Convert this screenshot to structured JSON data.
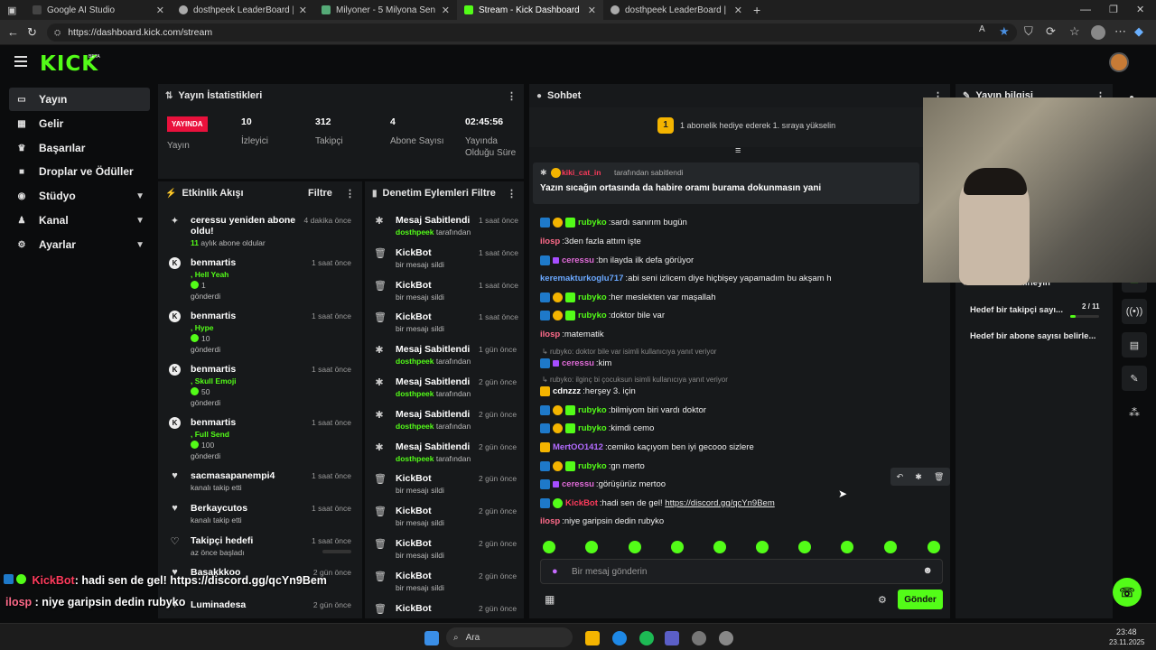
{
  "browser": {
    "tabs": [
      {
        "title": "Google AI Studio",
        "active": false
      },
      {
        "title": "dosthpeek LeaderBoard | The bes",
        "active": false
      },
      {
        "title": "Milyoner - 5 Milyona Sen de Ulaş",
        "active": false
      },
      {
        "title": "Stream - Kick Dashboard",
        "active": true
      },
      {
        "title": "dosthpeek LeaderBoard | The bes",
        "active": false
      }
    ],
    "url": "https://dashboard.kick.com/stream"
  },
  "brand": {
    "logo": "KICK",
    "beta": "BETA",
    "accent": "#53fc18"
  },
  "sidebar": [
    {
      "label": "Yayın",
      "icon": "screen-icon",
      "active": true
    },
    {
      "label": "Gelir",
      "icon": "dollar-icon"
    },
    {
      "label": "Başarılar",
      "icon": "trophy-icon"
    },
    {
      "label": "Droplar ve Ödüller",
      "icon": "gift-icon"
    },
    {
      "label": "Stüdyo",
      "icon": "studio-icon",
      "expandable": true
    },
    {
      "label": "Kanal",
      "icon": "person-icon",
      "expandable": true
    },
    {
      "label": "Ayarlar",
      "icon": "gear-icon",
      "expandable": true
    }
  ],
  "stats": {
    "title": "Yayın İstatistikleri",
    "live_badge": "YAYINDA",
    "live_label": "Yayın",
    "viewers": "10",
    "viewers_label": "İzleyici",
    "followers": "312",
    "followers_label": "Takipçi",
    "subs": "4",
    "subs_label": "Abone Sayısı",
    "duration": "02:45:56",
    "duration_label_1": "Yayında",
    "duration_label_2": "Olduğu Süre"
  },
  "activity": {
    "title": "Etkinlik Akışı",
    "filter": "Filtre",
    "items": [
      {
        "name": "ceressu yeniden abone oldu!",
        "time": "4 dakika önce",
        "sub": "11 aylık abone oldular"
      },
      {
        "name": "benmartis",
        "time": "1 saat önce",
        "gift": ", Hell Yeah",
        "count": "1",
        "sent": "gönderdi"
      },
      {
        "name": "benmartis",
        "time": "1 saat önce",
        "gift": ", Hype",
        "count": "10",
        "sent": "gönderdi"
      },
      {
        "name": "benmartis",
        "time": "1 saat önce",
        "gift": ", Skull Emoji",
        "count": "50",
        "sent": "gönderdi"
      },
      {
        "name": "benmartis",
        "time": "1 saat önce",
        "gift": ", Full Send",
        "count": "100",
        "sent": "gönderdi"
      },
      {
        "name": "sacmasapanempi4",
        "time": "1 saat önce",
        "sub": "kanalı takip etti"
      },
      {
        "name": "Berkaycutos",
        "time": "1 saat önce",
        "sub": "kanalı takip etti"
      },
      {
        "name": "Takipçi hedefi",
        "time": "1 saat önce",
        "sub": "az önce başladı"
      },
      {
        "name": "Basakkkoo",
        "time": "2 gün önce",
        "sub": ""
      },
      {
        "name": "Luminadesa",
        "time": "2 gün önce",
        "sub": ""
      }
    ]
  },
  "moderation": {
    "title": "Denetim Eylemleri",
    "filter": "Filtre",
    "items": [
      {
        "type": "pin",
        "name": "Mesaj Sabitlendi",
        "by": "dosthpeek",
        "suffix": "tarafından",
        "time": "1 saat önce"
      },
      {
        "type": "trash",
        "name": "KickBot",
        "sub": "bir mesajı sildi",
        "time": "1 saat önce"
      },
      {
        "type": "trash",
        "name": "KickBot",
        "sub": "bir mesajı sildi",
        "time": "1 saat önce"
      },
      {
        "type": "trash",
        "name": "KickBot",
        "sub": "bir mesajı sildi",
        "time": "1 saat önce"
      },
      {
        "type": "pin",
        "name": "Mesaj Sabitlendi",
        "by": "dosthpeek",
        "suffix": "tarafından",
        "time": "1 gün önce"
      },
      {
        "type": "pin",
        "name": "Mesaj Sabitlendi",
        "by": "dosthpeek",
        "suffix": "tarafından",
        "time": "2 gün önce"
      },
      {
        "type": "pin",
        "name": "Mesaj Sabitlendi",
        "by": "dosthpeek",
        "suffix": "tarafından",
        "time": "2 gün önce"
      },
      {
        "type": "pin",
        "name": "Mesaj Sabitlendi",
        "by": "dosthpeek",
        "suffix": "tarafından",
        "time": "2 gün önce"
      },
      {
        "type": "trash",
        "name": "KickBot",
        "sub": "bir mesajı sildi",
        "time": "2 gün önce"
      },
      {
        "type": "trash",
        "name": "KickBot",
        "sub": "bir mesajı sildi",
        "time": "2 gün önce"
      },
      {
        "type": "trash",
        "name": "KickBot",
        "sub": "bir mesajı sildi",
        "time": "2 gün önce"
      },
      {
        "type": "trash",
        "name": "KickBot",
        "sub": "bir mesajı sildi",
        "time": "2 gün önce"
      },
      {
        "type": "trash",
        "name": "KickBot",
        "sub": "",
        "time": "2 gün önce"
      }
    ]
  },
  "chat": {
    "title": "Sohbet",
    "gift_banner": "1 abonelik hediye ederek 1. sıraya yükselin",
    "gift_rank": "1",
    "pinned_by_user": "kiki_cat_in",
    "pinned_by_suffix": "tarafından sabitlendi",
    "pinned_text": "Yazın sıcağın ortasında da habire oramı burama dokunmasın yani",
    "messages": [
      {
        "user": "rubyko",
        "color": "#53fc18",
        "text": "sardı sanırım bugün",
        "badges": [
          "blue",
          "gold",
          "green"
        ]
      },
      {
        "user": "ilosp",
        "color": "#ff6b8a",
        "text": "3den fazla attım işte",
        "badges": []
      },
      {
        "user": "ceressu",
        "color": "#e06bd8",
        "text": "bn ilayda ilk defa görüyor",
        "badges": [
          "blue",
          "purple"
        ]
      },
      {
        "user": "keremakturkoglu717",
        "color": "#6aa8ff",
        "text": "abi seni izlicem diye hiçbişey yapamadım bu akşam h",
        "badges": []
      },
      {
        "user": "rubyko",
        "color": "#53fc18",
        "text": "her meslekten var maşallah",
        "badges": [
          "blue",
          "gold",
          "green"
        ]
      },
      {
        "user": "rubyko",
        "color": "#53fc18",
        "text": "doktor bile var",
        "badges": [
          "blue",
          "gold",
          "green"
        ]
      },
      {
        "user": "ilosp",
        "color": "#ff6b8a",
        "text": "matematik",
        "badges": []
      },
      {
        "reply": "rubyko: doktor bile var isimli kullanıcıya yanıt veriyor"
      },
      {
        "user": "ceressu",
        "color": "#e06bd8",
        "text": "kim",
        "badges": [
          "blue",
          "purple"
        ]
      },
      {
        "reply": "rubyko: ilginç bi çocuksun isimli kullanıcıya yanıt veriyor"
      },
      {
        "user": "cdnzzz",
        "color": "#ffffff",
        "text": "herşey 3. için",
        "badges": [
          "crown"
        ]
      },
      {
        "user": "rubyko",
        "color": "#53fc18",
        "text": "bilmiyom biri vardı doktor",
        "badges": [
          "blue",
          "gold",
          "green"
        ]
      },
      {
        "user": "rubyko",
        "color": "#53fc18",
        "text": "kimdi cemo",
        "badges": [
          "blue",
          "gold",
          "green"
        ]
      },
      {
        "user": "MertOO1412",
        "color": "#b36bff",
        "text": "cemiko kaçıyom ben iyi gecooo sizlere",
        "badges": [
          "crown"
        ]
      },
      {
        "user": "rubyko",
        "color": "#53fc18",
        "text": "gn merto",
        "badges": [
          "blue",
          "gold",
          "green"
        ]
      },
      {
        "user": "ceressu",
        "color": "#e06bd8",
        "text": "görüşürüz mertoo",
        "badges": [
          "blue",
          "purple"
        ]
      },
      {
        "user": "KickBot",
        "color": "#ff3b5c",
        "text": "hadi sen de gel! ",
        "link": "https://discord.gg/qcYn9Bem",
        "badges": [
          "blue",
          "greencheck"
        ]
      },
      {
        "user": "ilosp",
        "color": "#ff6b8a",
        "text": "niye garipsin dedin rubyko",
        "badges": []
      }
    ],
    "input_placeholder": "Bir mesaj gönderin",
    "send_label": "Gönder"
  },
  "stream_info": {
    "title": "Yayın bilgisi",
    "goals_header": "Hedefleri belirleyin",
    "goal1_label": "Hedef bir takipçi sayı...",
    "goal1_progress": "2 / 11",
    "goal1_fraction": 0.18,
    "goal2_label": "Hedef bir abone sayısı belirle..."
  },
  "overlay": {
    "line1_user": "KickBot",
    "line1_text": ": hadi sen de gel! https://discord.gg/qcYn9Bem",
    "line2_user": "ilosp",
    "line2_text": " : niye garipsin dedin rubyko"
  },
  "taskbar": {
    "search": "Ara",
    "time": "23:48",
    "date": "23.11.2025"
  }
}
